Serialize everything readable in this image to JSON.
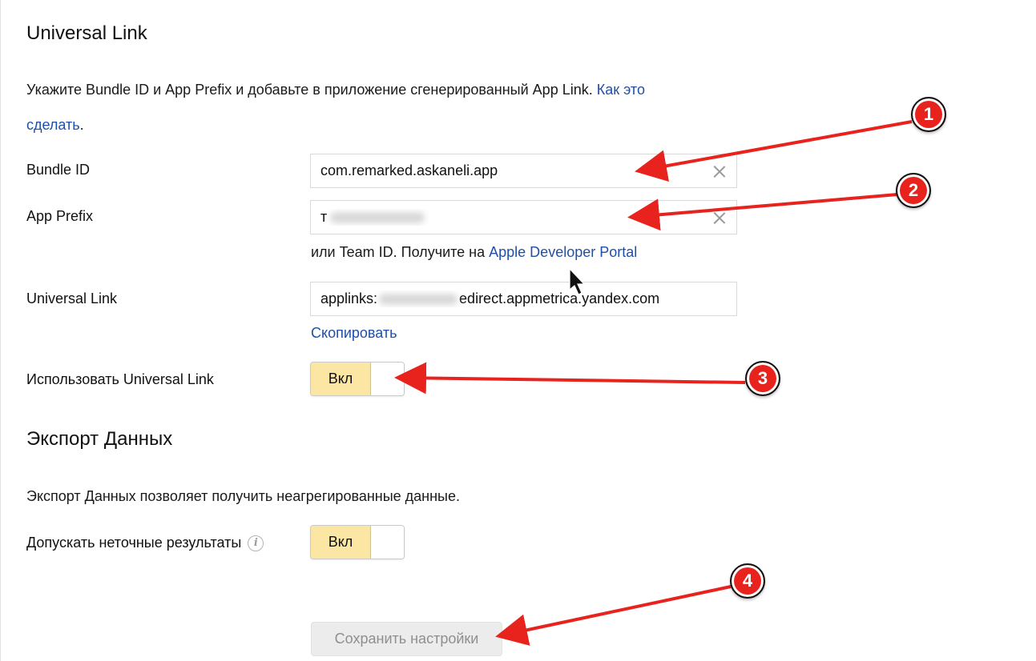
{
  "universal_link_section": {
    "title": "Universal Link",
    "description": "Укажите Bundle ID и App Prefix и добавьте в приложение сгенерированный App Link.",
    "help_link_line1": "Как это",
    "help_link_line2": "сделать",
    "help_period": "."
  },
  "bundle_id": {
    "label": "Bundle ID",
    "value": "com.remarked.askaneli.app"
  },
  "app_prefix": {
    "label": "App Prefix",
    "value_visible": "т",
    "hint_text": "или Team ID. Получите на",
    "hint_link": "Apple Developer Portal"
  },
  "universal_link": {
    "label": "Universal Link",
    "value_prefix": "applinks:",
    "value_suffix": "edirect.appmetrica.yandex.com",
    "copy_link": "Скопировать"
  },
  "use_universal_link": {
    "label": "Использовать Universal Link",
    "toggle_label": "Вкл",
    "enabled": true
  },
  "export_section": {
    "title": "Экспорт Данных",
    "description": "Экспорт Данных позволяет получить неагрегированные данные."
  },
  "allow_inexact": {
    "label": "Допускать неточные результаты",
    "info_glyph": "i",
    "toggle_label": "Вкл",
    "enabled": true
  },
  "save_button": {
    "label": "Сохранить настройки"
  },
  "annotations": {
    "badge_1": "1",
    "badge_2": "2",
    "badge_3": "3",
    "badge_4": "4"
  },
  "colors": {
    "link": "#1f4fa8",
    "toggle_on": "#fbe6a3",
    "annotation_red": "#e8231d",
    "button_disabled_bg": "#ececec",
    "button_disabled_text": "#8f8f8f"
  }
}
